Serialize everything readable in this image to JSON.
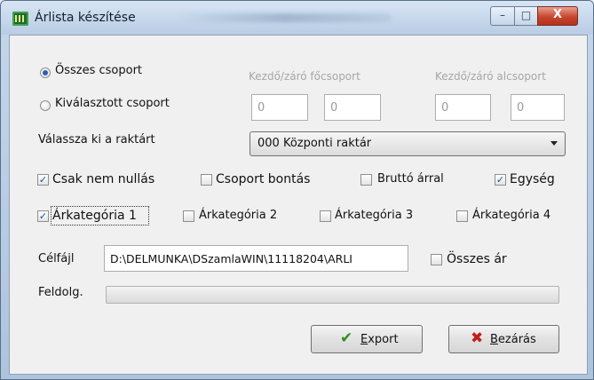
{
  "window": {
    "title": "Árlista készítése",
    "min_glyph": "–",
    "max_glyph": "□",
    "close_glyph": "X"
  },
  "group_select": {
    "all_label": "Összes csoport",
    "selected_label": "Kiválasztott csoport",
    "selected_value": "all"
  },
  "range": {
    "main_group_label": "Kezdő/záró főcsoport",
    "sub_group_label": "Kezdő/záró alcsoport",
    "main_from": "0",
    "main_to": "0",
    "sub_from": "0",
    "sub_to": "0"
  },
  "warehouse": {
    "label": "Válassza ki a raktárt",
    "selected": "000 Központi raktár"
  },
  "options": {
    "non_zero": {
      "label": "Csak nem nullás",
      "checked": true
    },
    "group_split": {
      "label": "Csoport bontás",
      "checked": false
    },
    "gross_price": {
      "label": "Bruttó árral",
      "checked": false
    },
    "unit": {
      "label": "Egység",
      "checked": true
    }
  },
  "price_categories": [
    {
      "label": "Árkategória 1",
      "checked": true
    },
    {
      "label": "Árkategória 2",
      "checked": false
    },
    {
      "label": "Árkategória 3",
      "checked": false
    },
    {
      "label": "Árkategória 4",
      "checked": false
    }
  ],
  "target_file": {
    "label": "Célfájl",
    "value": "D:\\DELMUNKA\\DSzamlaWIN\\11118204\\ARLI"
  },
  "all_prices": {
    "label": "Összes ár",
    "checked": false
  },
  "processing": {
    "label": "Feldolg.",
    "progress": 0
  },
  "buttons": {
    "export_label_prefix": "",
    "export_accel": "E",
    "export_rest": "xport",
    "close_accel": "B",
    "close_rest": "ezárás"
  },
  "icons": {
    "export": "check-icon",
    "close": "x-icon",
    "check_color": "#2f8f1f",
    "x_color": "#c0201a"
  }
}
